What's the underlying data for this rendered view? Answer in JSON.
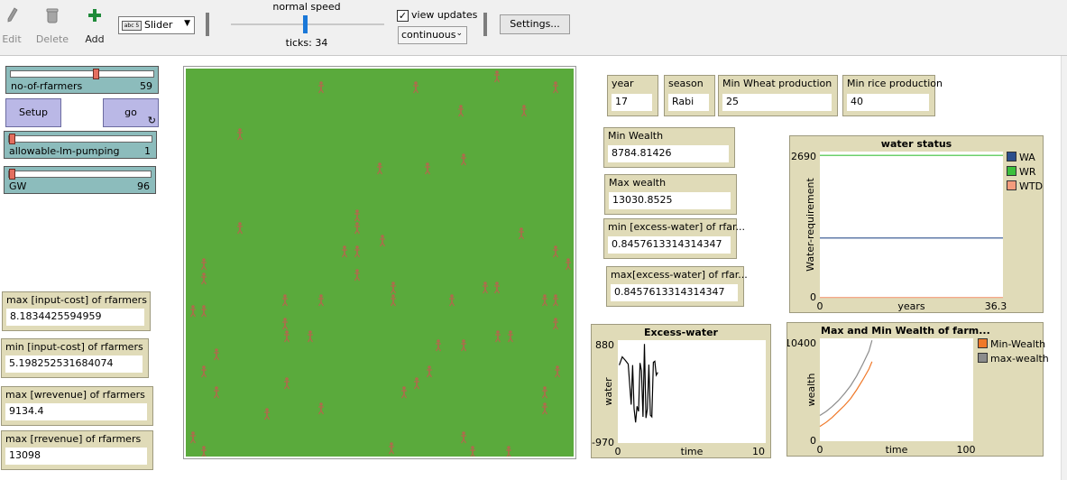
{
  "toolbar": {
    "edit_label": "Edit",
    "delete_label": "Delete",
    "add_label": "Add",
    "widget_type": "Slider",
    "widget_icon_text": "abc 5",
    "speed_label": "normal speed",
    "speed_fraction": 0.5,
    "ticks_label": "ticks: 34",
    "view_updates_label": "view updates",
    "view_updates_checked": true,
    "update_mode": "continuous",
    "settings_label": "Settings..."
  },
  "sliders": [
    {
      "name": "no-of-rfarmers",
      "value": "59",
      "fraction": 0.59
    },
    {
      "name": "allowable-lm-pumping",
      "value": "1",
      "fraction": 0.0
    },
    {
      "name": "GW",
      "value": "96",
      "fraction": 0.0
    }
  ],
  "buttons": {
    "setup_label": "Setup",
    "go_label": "go"
  },
  "left_monitors": [
    {
      "label": "max [input-cost] of rfarmers",
      "value": "8.1834425594959"
    },
    {
      "label": "min [input-cost] of rfarmers",
      "value": "5.198252531684074"
    },
    {
      "label": "max [wrevenue] of rfarmers",
      "value": "9134.4"
    },
    {
      "label": "max [rrevenue] of rfarmers",
      "value": "13098"
    }
  ],
  "top_monitors": [
    {
      "label": "year",
      "value": "17"
    },
    {
      "label": "season",
      "value": "Rabi"
    },
    {
      "label": "Min Wheat production",
      "value": "25"
    },
    {
      "label": "Min rice production",
      "value": "40"
    }
  ],
  "mid_monitors": [
    {
      "label": "Min Wealth",
      "value": "8784.81426"
    },
    {
      "label": "Max wealth",
      "value": "13030.8525"
    },
    {
      "label": "min [excess-water] of rfar...",
      "value": "0.8457613314314347"
    },
    {
      "label": "max[excess-water] of rfar...",
      "value": "0.8457613314314347"
    }
  ],
  "world": {
    "background_color": "#5aaa3c",
    "agent_color": "#b06a4c"
  },
  "chart_data": [
    {
      "type": "line",
      "title": "water status",
      "xlabel": "years",
      "ylabel": "Water-requirement",
      "x_min_label": "0",
      "x_max_label": "36.3",
      "y_min_label": "0",
      "y_max_label": "2690",
      "xlim": [
        0,
        36.3
      ],
      "ylim": [
        0,
        2690
      ],
      "series": [
        {
          "name": "WA",
          "color": "#2c4f8c",
          "x": [
            0,
            36.3
          ],
          "values": [
            1100,
            1100
          ]
        },
        {
          "name": "WR",
          "color": "#3cc03c",
          "x": [
            0,
            36.3
          ],
          "values": [
            2620,
            2620
          ]
        },
        {
          "name": "WTD",
          "color": "#f49c7c",
          "x": [
            0,
            36.3
          ],
          "values": [
            5,
            5
          ]
        }
      ]
    },
    {
      "type": "line",
      "title": "Excess-water",
      "xlabel": "time",
      "ylabel": "water",
      "x_min_label": "0",
      "x_max_label": "10",
      "y_min_label": "-970",
      "y_max_label": "880",
      "xlim": [
        0,
        10
      ],
      "ylim": [
        -970,
        880
      ],
      "series": [
        {
          "name": "",
          "color": "#000000",
          "x": [
            0.1,
            0.3,
            0.5,
            0.7,
            0.9,
            1.0,
            1.1,
            1.2,
            1.3,
            1.4,
            1.5,
            1.6,
            1.7,
            1.8,
            1.9,
            2.0,
            2.1,
            2.2,
            2.3,
            2.4,
            2.5,
            2.6,
            2.7
          ],
          "values": [
            430,
            580,
            520,
            450,
            -280,
            430,
            -350,
            -600,
            -310,
            -400,
            470,
            330,
            -500,
            810,
            -520,
            -350,
            440,
            -470,
            -500,
            480,
            500,
            250,
            300
          ]
        }
      ]
    },
    {
      "type": "line",
      "title": "Max and Min Wealth of farm...",
      "xlabel": "time",
      "ylabel": "wealth",
      "x_min_label": "0",
      "x_max_label": "100",
      "y_min_label": "0",
      "y_max_label": "10400",
      "xlim": [
        0,
        100
      ],
      "ylim": [
        0,
        10400
      ],
      "series": [
        {
          "name": "Min-Wealth",
          "color": "#f07828",
          "x": [
            0,
            4,
            8,
            12,
            16,
            20,
            24,
            28,
            32,
            34
          ],
          "values": [
            1500,
            1900,
            2400,
            3000,
            3600,
            4300,
            5200,
            6200,
            7300,
            8050
          ]
        },
        {
          "name": "max-wealth",
          "color": "#8c8c8c",
          "x": [
            0,
            4,
            8,
            12,
            16,
            20,
            24,
            28,
            32,
            34
          ],
          "values": [
            2600,
            3000,
            3500,
            4100,
            4800,
            5600,
            6600,
            7800,
            9100,
            10200
          ]
        }
      ]
    }
  ]
}
